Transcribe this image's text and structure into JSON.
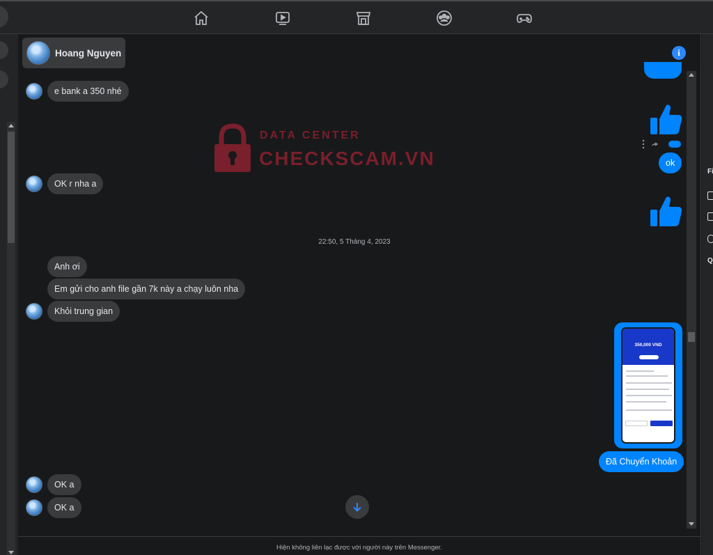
{
  "topnav": {
    "items": [
      {
        "icon": "home-icon"
      },
      {
        "icon": "watch-icon"
      },
      {
        "icon": "marketplace-icon"
      },
      {
        "icon": "groups-icon"
      },
      {
        "icon": "gaming-icon"
      }
    ]
  },
  "chat_header": {
    "name": "Hoang Nguyen",
    "info_icon_glyph": "i"
  },
  "watermark": {
    "small": "DATA CENTER",
    "big": "CHECKSCAM.VN"
  },
  "messages": {
    "in_1": "e bank a 350 nhé",
    "in_2": "OK r nha a",
    "timestamp": "22:50, 5 Tháng 4, 2023",
    "in_3": "Anh ơi",
    "in_4": "Em gửi cho anh file gần 7k này a chạy luôn nha",
    "in_5": "Khỏi trung gian",
    "out_ok": "ok",
    "out_transfer": "Đã Chuyển Khoản",
    "in_6": "OK a",
    "in_7": "OK a"
  },
  "transfer_image": {
    "amount": "350,000 VND"
  },
  "footer": {
    "notice": "Hiện không liên lạc được với người này trên Messenger."
  },
  "right_panel": {
    "label_1": "Fi",
    "label_2": "Q"
  },
  "colors": {
    "background": "#18191a",
    "bubble_in": "#3a3b3c",
    "bubble_out": "#0084ff",
    "watermark": "#7a1f2c"
  }
}
